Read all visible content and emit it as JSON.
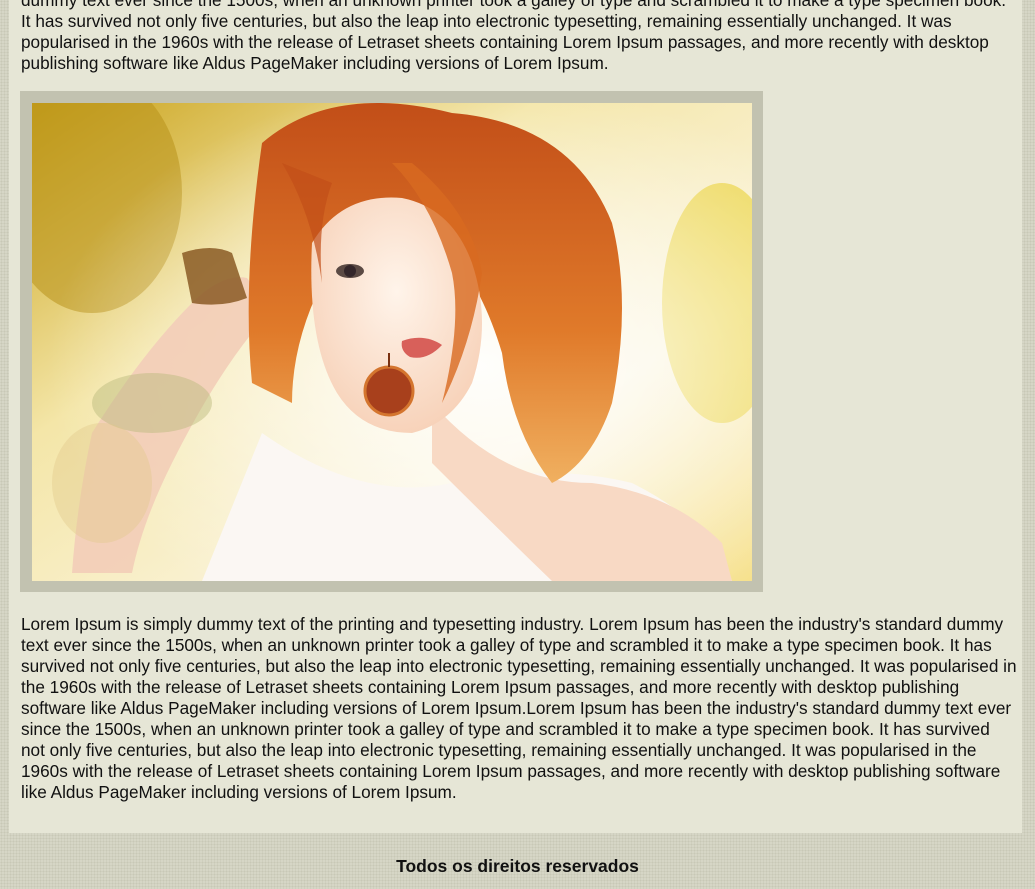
{
  "article": {
    "intro_text": "dummy text ever since the 1500s, when an unknown printer took a galley of type and scrambled it to make a type specimen book. It has survived not only five centuries, but also the leap into electronic typesetting, remaining essentially unchanged. It was popularised in the 1960s with the release of Letraset sheets containing Lorem Ipsum passages, and more recently with desktop publishing software like Aldus PageMaker including versions of Lorem Ipsum.",
    "image_alt": "Woman with red hair in white top",
    "body_text": "Lorem Ipsum is simply dummy text of the printing and typesetting industry. Lorem Ipsum has been the industry's standard dummy text ever since the 1500s, when an unknown printer took a galley of type and scrambled it to make a type specimen book. It has survived not only five centuries, but also the leap into electronic typesetting, remaining essentially unchanged. It was popularised in the 1960s with the release of Letraset sheets containing Lorem Ipsum passages, and more recently with desktop publishing software like Aldus PageMaker including versions of Lorem Ipsum.Lorem Ipsum has been the industry's standard dummy text ever since the 1500s, when an unknown printer took a galley of type and scrambled it to make a type specimen book. It has survived not only five centuries, but also the leap into electronic typesetting, remaining essentially unchanged. It was popularised in the 1960s with the release of Letraset sheets containing Lorem Ipsum passages, and more recently with desktop publishing software like Aldus PageMaker including versions of Lorem Ipsum."
  },
  "footer": {
    "copyright": "Todos os direitos reservados"
  },
  "colors": {
    "page_background": "#d6d6c6",
    "content_background": "#e6e6d6",
    "image_frame": "#c2c2b0"
  }
}
